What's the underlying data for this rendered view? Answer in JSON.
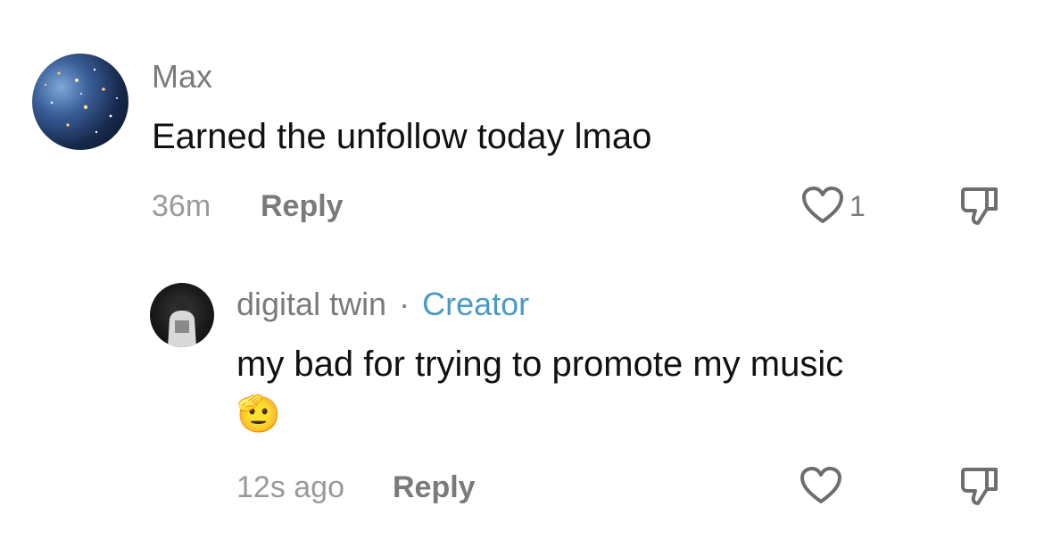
{
  "comments": [
    {
      "username": "Max",
      "text": "Earned the unfollow today lmao",
      "time": "36m",
      "reply_label": "Reply",
      "likes": "1"
    },
    {
      "username": "digital twin",
      "separator": "·",
      "badge": "Creator",
      "text": "my bad for trying to promote my music",
      "emoji": "🫡",
      "time": "12s ago",
      "reply_label": "Reply"
    }
  ],
  "colors": {
    "creator_badge": "#4a9bc2",
    "secondary_text": "#7a7a7a",
    "primary_text": "#111111"
  },
  "icons": [
    "heart-icon",
    "thumbs-down-icon"
  ]
}
